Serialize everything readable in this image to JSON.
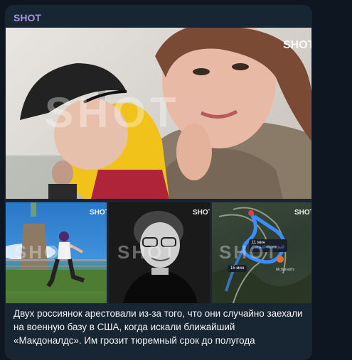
{
  "message": {
    "channel_name": "SHOT",
    "watermark": "SHOT",
    "caption": "Двух россиянок арестовали из-за того, что они случайно заехали на военную базу в США, когда искали ближайший «Макдоналдс». Им грозит тюремный срок до полугода"
  },
  "map": {
    "route_time_main": "11 мин",
    "route_label_main": "Самый быстрый",
    "route_time_alt": "15 мин",
    "place_label": "McDonald's"
  },
  "colors": {
    "background": "#0e1621",
    "bubble": "#182533",
    "channel_name": "#a695e7",
    "text": "#f5f5f5",
    "route": "#3b8cff"
  }
}
